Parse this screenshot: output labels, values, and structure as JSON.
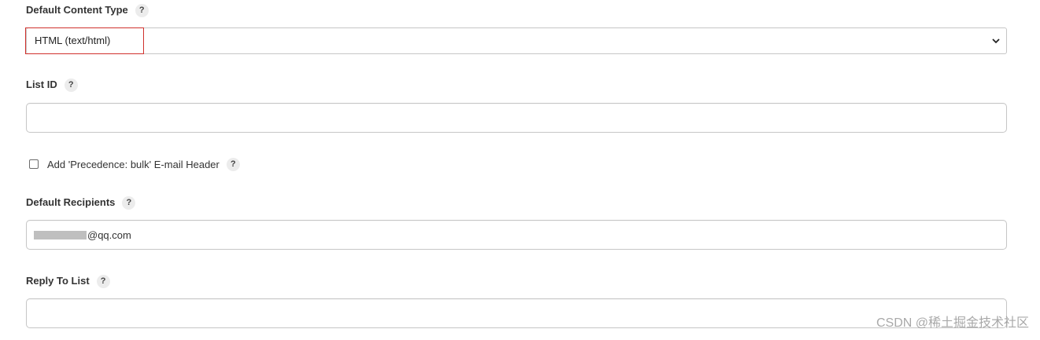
{
  "content_type": {
    "label": "Default Content Type",
    "help": "?",
    "selected": "HTML (text/html)"
  },
  "list_id": {
    "label": "List ID",
    "help": "?",
    "value": ""
  },
  "precedence": {
    "label": "Add 'Precedence: bulk' E-mail Header",
    "help": "?",
    "checked": false
  },
  "recipients": {
    "label": "Default Recipients",
    "help": "?",
    "value_suffix": "@qq.com"
  },
  "reply_to": {
    "label": "Reply To List",
    "help": "?",
    "value": ""
  },
  "watermark": "CSDN @稀土掘金技术社区"
}
